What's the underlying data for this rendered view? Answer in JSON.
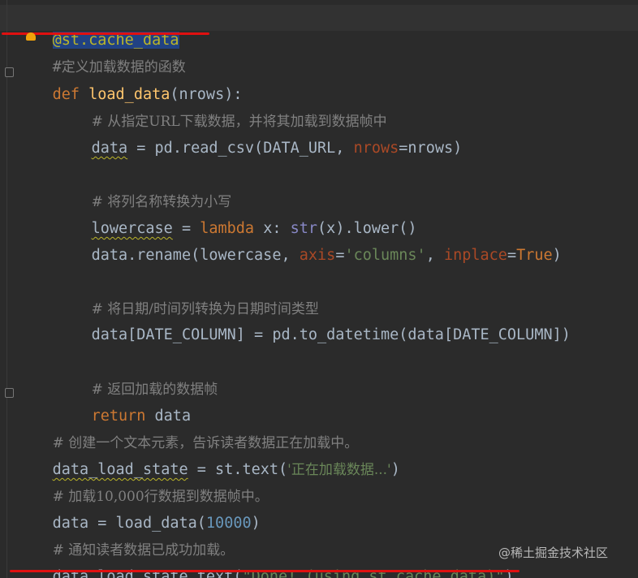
{
  "editor": {
    "lines": [
      {
        "text": "@st.cache_data"
      },
      {
        "text": "#"
      },
      {
        "text": "定义加载数据的函数"
      },
      {
        "text": "def"
      },
      {
        "text": "load_data"
      },
      {
        "text": "(nrows):"
      },
      {
        "text": "# 从指定URL下载数据，并将其加载到数据帧中"
      },
      {
        "text": "data"
      },
      {
        "text": " = pd.read_csv(DATA_URL, "
      },
      {
        "text": "nrows"
      },
      {
        "text": "=nrows)"
      },
      {
        "text": "# 将列名称转换为小写"
      },
      {
        "text": "lowercase"
      },
      {
        "text": " = "
      },
      {
        "text": "lambda"
      },
      {
        "text": " x: "
      },
      {
        "text": "str"
      },
      {
        "text": "(x).lower()"
      },
      {
        "text": "data.rename(lowercase, "
      },
      {
        "text": "axis"
      },
      {
        "text": "="
      },
      {
        "text": "'columns'"
      },
      {
        "text": ", "
      },
      {
        "text": "inplace"
      },
      {
        "text": "="
      },
      {
        "text": "True"
      },
      {
        "text": ")"
      },
      {
        "text": "# 将日期/时间列转换为日期时间类型"
      },
      {
        "text": "data[DATE_COLUMN] = pd.to_datetime(data[DATE_COLUMN])"
      },
      {
        "text": "# 返回加载的数据帧"
      },
      {
        "text": "return"
      },
      {
        "text": " data"
      },
      {
        "text": "# 创建一个文本元素，告诉读者数据正在加载中。"
      },
      {
        "text": "data_load_state"
      },
      {
        "text": " = st.text("
      },
      {
        "text": "'正在加载数据...'"
      },
      {
        "text": ")"
      },
      {
        "text": "# 加载10,000行数据到数据帧中。"
      },
      {
        "text": "data = load_data("
      },
      {
        "text": "10000"
      },
      {
        "text": ")"
      },
      {
        "text": "# 通知读者数据已成功加载。"
      },
      {
        "text": "data_load_state.text("
      },
      {
        "text": "\"Done! (using st.cache_data)\""
      },
      {
        "text": ")"
      }
    ]
  },
  "watermark": {
    "text": "@稀土掘金技术社区"
  },
  "colors": {
    "background": "#2b2b2b",
    "keyword": "#cc7832",
    "function": "#ffc66d",
    "string": "#6a8759",
    "number": "#6897bb",
    "comment": "#808080",
    "param": "#aa4926",
    "annotation_red": "#e01010"
  },
  "icons": [
    "lightbulb-icon",
    "fold-marker-icon"
  ]
}
